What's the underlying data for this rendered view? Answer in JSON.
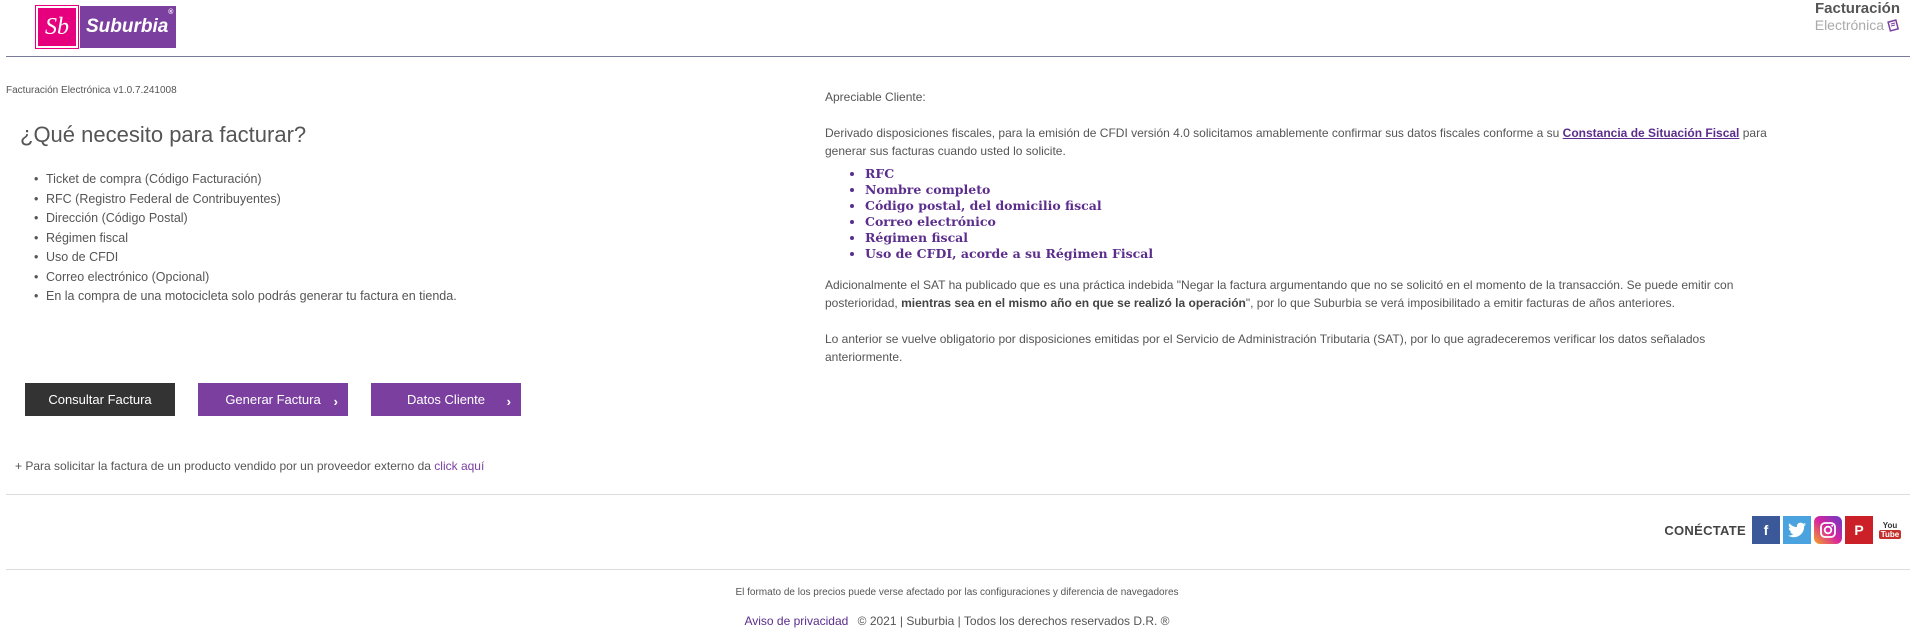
{
  "header": {
    "logo_mark": "Sb",
    "logo_word": "Suburbia",
    "logo_reg": "®",
    "title_line1": "Facturación",
    "title_line2": "Electrónica"
  },
  "version": "Facturación Electrónica v1.0.7.241008",
  "left": {
    "title": "¿Qué necesito para facturar?",
    "items": [
      "Ticket de compra (Código Facturación)",
      "RFC (Registro Federal de Contribuyentes)",
      "Dirección (Código Postal)",
      "Régimen fiscal",
      "Uso de CFDI",
      "Correo electrónico (Opcional)",
      "En la compra de una motocicleta solo podrás generar tu factura en tienda."
    ]
  },
  "buttons": {
    "consultar": "Consultar Factura",
    "generar": "Generar Factura",
    "datos": "Datos Cliente"
  },
  "external": {
    "prefix": "+ Para solicitar la factura de un producto vendido por un proveedor externo da",
    "link": "click aquí"
  },
  "right": {
    "greeting": "Apreciable Cliente:",
    "p1_before": "Derivado disposiciones fiscales, para la emisión de CFDI versión 4.0 solicitamos amablemente confirmar sus datos fiscales conforme a su",
    "p1_link": "Constancia de Situación Fiscal",
    "p1_after": "para generar sus facturas cuando usted lo solicite.",
    "fiscal_items": [
      "RFC",
      "Nombre completo",
      "Código postal, del domicilio fiscal",
      "Correo electrónico",
      "Régimen fiscal",
      "Uso de CFDI, acorde a su Régimen Fiscal"
    ],
    "p2_before": "Adicionalmente el SAT ha publicado que es una práctica indebida \"Negar la factura argumentando que no se solicitó en el momento de la transacción. Se puede emitir con posterioridad,",
    "p2_bold": "mientras sea en el mismo año en que se realizó la operación",
    "p2_after": "\", por lo que Suburbia se verá imposibilitado a emitir facturas de años anteriores.",
    "p3": "Lo anterior se vuelve obligatorio por disposiciones emitidas por el Servicio de Administración Tributaria (SAT), por lo que agradeceremos verificar los datos señalados anteriormente."
  },
  "social": {
    "label": "CONÉCTATE",
    "icons": [
      "facebook-icon",
      "twitter-icon",
      "instagram-icon",
      "pinterest-icon",
      "youtube-icon"
    ],
    "fb": "f",
    "pi": "P",
    "yt_top": "You",
    "yt_bottom": "Tube"
  },
  "footer": {
    "prices_note": "El formato de los precios puede verse afectado por las configuraciones y diferencia de navegadores",
    "privacy_link": "Aviso de privacidad",
    "copyright": "© 2021 | Suburbia | Todos los derechos reservados D.R. ®"
  },
  "colors": {
    "brand_purple": "#7b3fa0",
    "brand_pink": "#e6007e",
    "dark_button": "#333333"
  }
}
